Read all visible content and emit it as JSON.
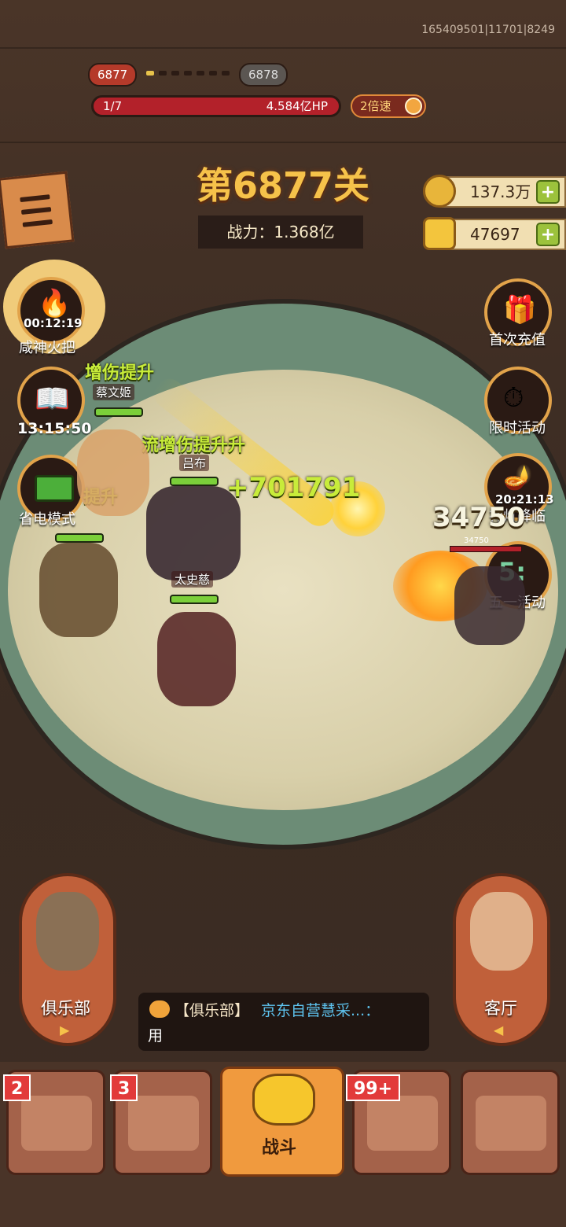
{
  "build_id": "165409501|11701|8249",
  "level_nav": {
    "current": "6877",
    "next": "6878"
  },
  "wave": {
    "progress": "1/7",
    "boss_hp": "4.584亿HP"
  },
  "speed": {
    "label": "2倍速"
  },
  "stage": {
    "title": "第6877关",
    "power": "战力：1.368亿"
  },
  "currency": {
    "coins": "137.3万",
    "gold": "47697",
    "plus": "+"
  },
  "left_buttons": [
    {
      "label": "咸神火把",
      "timer": "00:12:19",
      "icon": "torch-icon"
    },
    {
      "label": "",
      "timer": "13:15:50",
      "icon": "book-icon"
    },
    {
      "label": "省电模式",
      "timer": "",
      "icon": "battery-icon"
    }
  ],
  "right_buttons": [
    {
      "label": "首次充值",
      "timer": "",
      "icon": "gift-icon"
    },
    {
      "label": "限时活动",
      "timer": "",
      "icon": "clock-icon"
    },
    {
      "label": "神灯降临",
      "timer": "20:21:13",
      "icon": "lamp-icon"
    },
    {
      "label": "五一活动",
      "timer": "",
      "icon": "holiday-icon"
    }
  ],
  "battle": {
    "buff1": "增伤提升",
    "buff2": "流增伤提升升",
    "buff3": "提升",
    "hero1": "蔡文姬",
    "hero2": "吕布",
    "hero3": "太史慈",
    "damage": "+701791",
    "enemy_damage": "34750",
    "enemy_hp": "34750"
  },
  "side": {
    "left_label": "俱乐部",
    "right_label": "客厅"
  },
  "chat": {
    "channel": "【俱乐部】",
    "sender": "京东自营慧采...：",
    "message": "用"
  },
  "tabs": [
    {
      "badge": "2",
      "label": ""
    },
    {
      "badge": "3",
      "label": ""
    },
    {
      "badge": "",
      "label": "战斗"
    },
    {
      "badge": "99+",
      "label": ""
    },
    {
      "badge": "",
      "label": ""
    }
  ],
  "colors": {
    "accent": "#f6c24a",
    "hp_red": "#b3212a",
    "buff_green": "#c8ec3a"
  }
}
